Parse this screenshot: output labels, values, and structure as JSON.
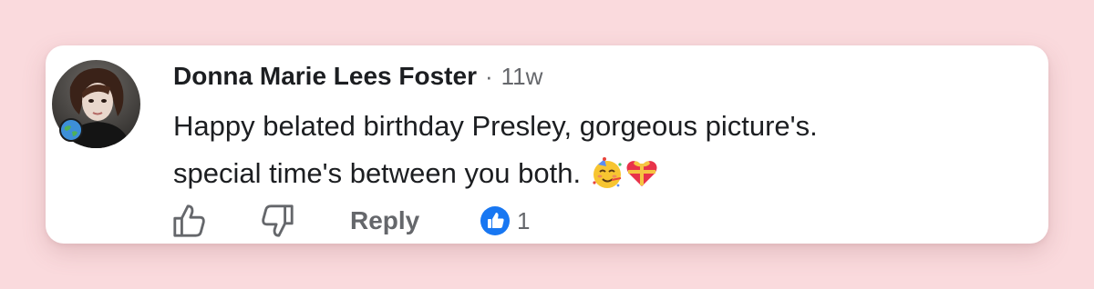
{
  "comment": {
    "author": "Donna Marie Lees Foster",
    "separator": "·",
    "timestamp": "11w",
    "text_line1": "Happy belated birthday Presley, gorgeous picture's.",
    "text_line2": "special time's between you both.",
    "emojis": [
      "partying-face-emoji",
      "heart-with-ribbon-emoji"
    ]
  },
  "actions": {
    "like_icon": "thumbs-up-outline-icon",
    "dislike_icon": "thumbs-down-outline-icon",
    "reply_label": "Reply",
    "reaction_icon": "like-reaction-badge-icon",
    "reaction_count": "1"
  },
  "colors": {
    "page_background": "#fadadd",
    "card_background": "#ffffff",
    "primary_text": "#1c1e21",
    "secondary_text": "#65676b",
    "like_blue": "#1877f2"
  }
}
